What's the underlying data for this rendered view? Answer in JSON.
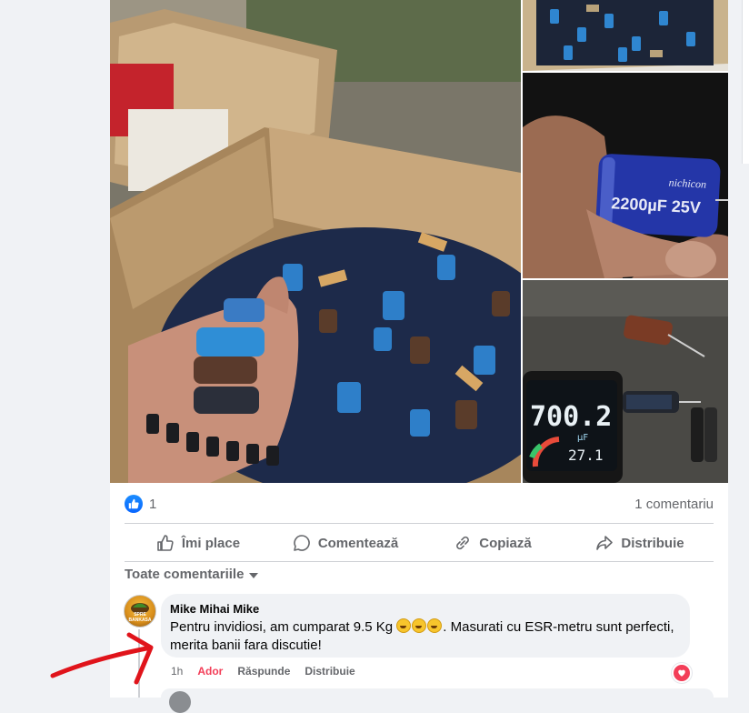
{
  "post": {
    "reactions": {
      "like_count": "1",
      "comment_count": "1 comentariu"
    },
    "actions": [
      {
        "label": "Îmi place",
        "icon": "thumbs-up-icon"
      },
      {
        "label": "Comentează",
        "icon": "comment-icon"
      },
      {
        "label": "Copiază",
        "icon": "link-icon"
      },
      {
        "label": "Distribuie",
        "icon": "share-icon"
      }
    ],
    "comments_filter": "Toate comentariile"
  },
  "comment": {
    "author": "Mike Mihai Mike",
    "avatar_text": "SPRE BANKASA",
    "text_before": "Pentru invidiosi, am cumparat 9.5 Kg",
    "text_after": ". Masurati cu ESR-metru sunt perfecti, merita banii fara discutie!",
    "emoji_count": 3,
    "time": "1h",
    "reaction_label": "Ador",
    "reply_label": "Răspunde",
    "share_label": "Distribuie",
    "reaction_icon": "heart-icon"
  },
  "photos": {
    "capacitor_label_1": "2200µF 25V",
    "capacitor_label_2": "2200µF 25V",
    "brand": "nichicon",
    "meter_reading": "700.2",
    "meter_unit": "µF",
    "meter_secondary": "27.1"
  },
  "colors": {
    "accent": "#0866ff",
    "love": "#f33e58",
    "secondary_text": "#65676b",
    "annotation": "#e0141b"
  }
}
